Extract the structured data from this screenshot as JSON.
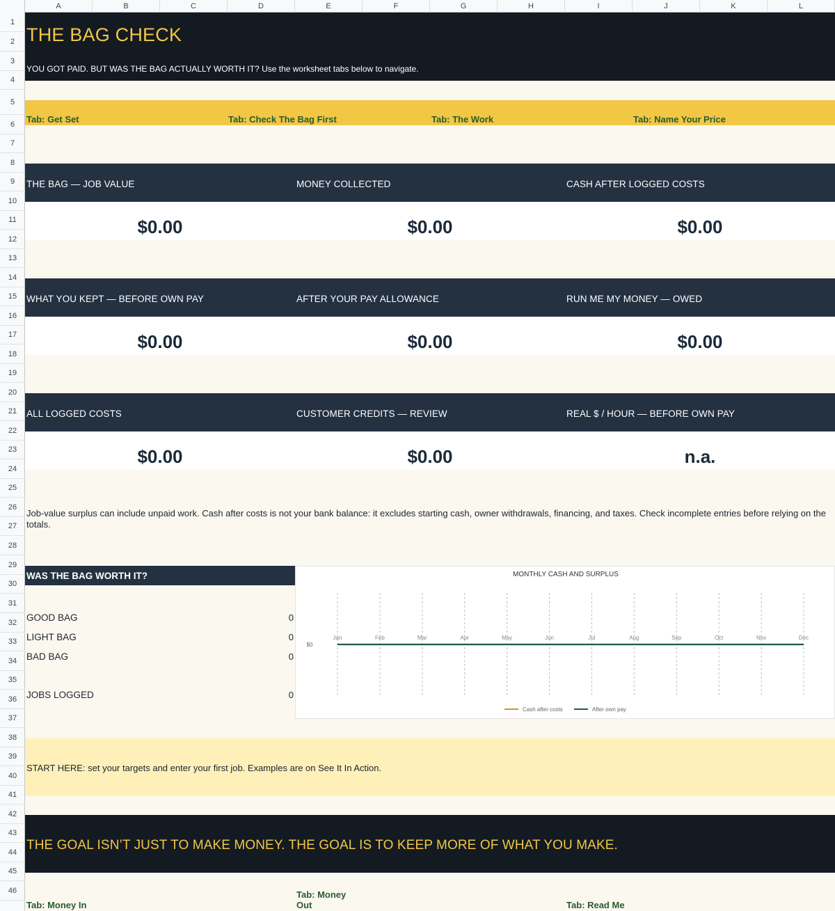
{
  "columns": [
    "A",
    "B",
    "C",
    "D",
    "E",
    "F",
    "G",
    "H",
    "I",
    "J",
    "K",
    "L"
  ],
  "rows": [
    "1",
    "2",
    "3",
    "4",
    "5",
    "6",
    "7",
    "8",
    "9",
    "10",
    "11",
    "12",
    "13",
    "14",
    "15",
    "16",
    "17",
    "18",
    "19",
    "20",
    "21",
    "22",
    "23",
    "24",
    "25",
    "26",
    "27",
    "28",
    "29",
    "30",
    "31",
    "32",
    "33",
    "34",
    "35",
    "36",
    "37",
    "38",
    "39",
    "40",
    "41",
    "42",
    "43",
    "44",
    "45",
    "46"
  ],
  "header": {
    "title": "THE BAG CHECK",
    "subtitle": "YOU GOT PAID. BUT WAS THE BAG ACTUALLY WORTH IT? Use the worksheet tabs below to navigate."
  },
  "tabs_top": [
    "Tab: Get Set",
    "Tab: Check The Bag First",
    "Tab: The Work",
    "Tab: Name Your Price"
  ],
  "cards": [
    {
      "label": "THE BAG — JOB VALUE",
      "value": "$0.00"
    },
    {
      "label": "MONEY COLLECTED",
      "value": "$0.00"
    },
    {
      "label": "CASH AFTER LOGGED COSTS",
      "value": "$0.00"
    },
    {
      "label": "WHAT YOU KEPT — BEFORE OWN PAY",
      "value": "$0.00"
    },
    {
      "label": "AFTER YOUR PAY ALLOWANCE",
      "value": "$0.00"
    },
    {
      "label": "RUN ME MY MONEY — OWED",
      "value": "$0.00"
    },
    {
      "label": "ALL LOGGED COSTS",
      "value": "$0.00"
    },
    {
      "label": "CUSTOMER CREDITS — REVIEW",
      "value": "$0.00"
    },
    {
      "label": "REAL $ / HOUR — BEFORE OWN PAY",
      "value": "n.a."
    }
  ],
  "note": "Job-value surplus can include unpaid work. Cash after costs is not your bank balance: it excludes starting cash, owner withdrawals, financing, and taxes. Check incomplete entries before relying on the totals.",
  "worth": {
    "title": "WAS THE BAG WORTH IT?",
    "rows": [
      {
        "label": "GOOD BAG",
        "value": "0"
      },
      {
        "label": "LIGHT BAG",
        "value": "0"
      },
      {
        "label": "BAD BAG",
        "value": "0"
      },
      {
        "label": "JOBS LOGGED",
        "value": "0"
      }
    ]
  },
  "start_here": "START HERE: set your targets and enter your first job. Examples are on See It In Action.",
  "goal": "THE GOAL ISN’T JUST TO MAKE MONEY. THE GOAL IS TO KEEP MORE OF WHAT YOU MAKE.",
  "tabs_bottom": [
    "Tab: Money In",
    "Tab: Money Out",
    "Tab: Read Me"
  ],
  "colors": {
    "dark": "#141a22",
    "navy": "#233141",
    "yellow": "#f1c744",
    "cream": "#fbf8ef",
    "green": "#2a5a2e"
  },
  "chart_data": {
    "type": "line",
    "title": "MONTHLY CASH AND SURPLUS",
    "categories": [
      "Jan",
      "Feb",
      "Mar",
      "Apr",
      "May",
      "Jun",
      "Jul",
      "Aug",
      "Sep",
      "Oct",
      "Nov",
      "Dec"
    ],
    "y_tick_labels": [
      "$0"
    ],
    "series": [
      {
        "name": "Cash after costs",
        "color": "#c99a1e",
        "values": [
          0,
          0,
          0,
          0,
          0,
          0,
          0,
          0,
          0,
          0,
          0,
          0
        ]
      },
      {
        "name": "After own pay",
        "color": "#1f5a46",
        "values": [
          0,
          0,
          0,
          0,
          0,
          0,
          0,
          0,
          0,
          0,
          0,
          0
        ]
      }
    ],
    "legend": "bottom",
    "grid": "vertical-dashed"
  }
}
